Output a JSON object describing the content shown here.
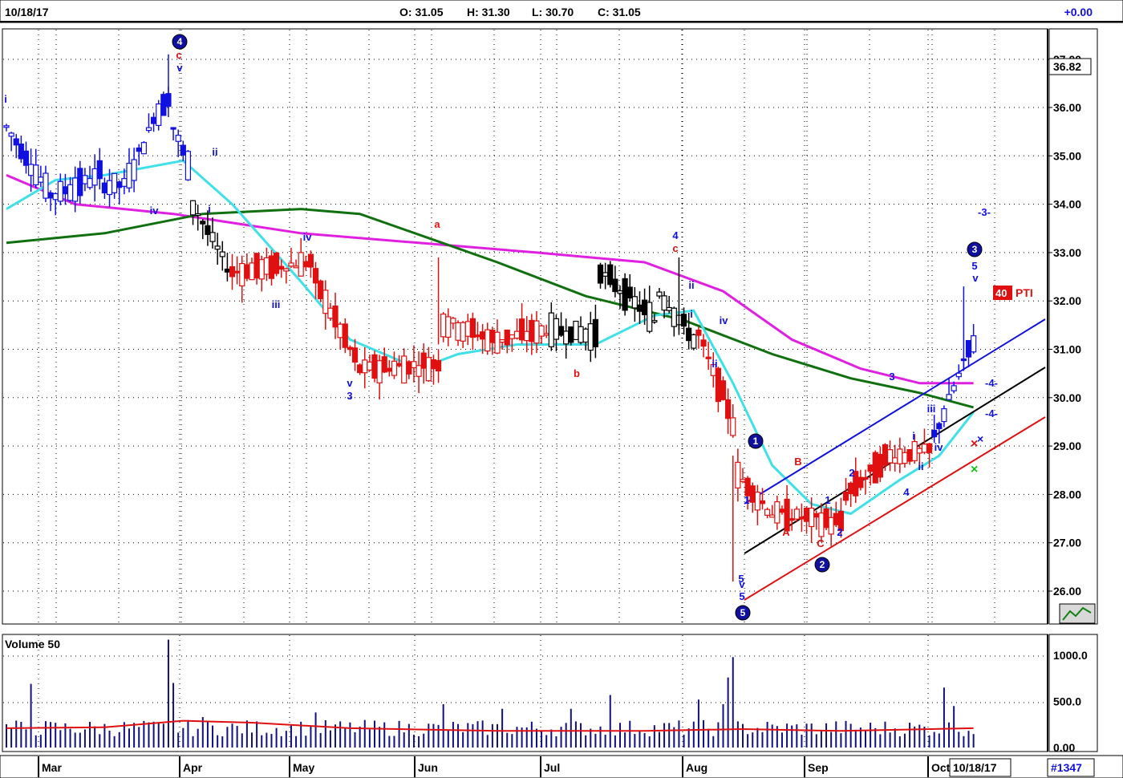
{
  "header": {
    "date": "10/18/17",
    "open": "O: 31.05",
    "high": "H: 31.30",
    "low": "L: 30.70",
    "close": "C: 31.05",
    "change": "+0.00"
  },
  "price_axis": {
    "last_price": "36.82",
    "ticks": [
      "27.00",
      "36.00",
      "35.00",
      "34.00",
      "33.00",
      "32.00",
      "31.00",
      "30.00",
      "29.00",
      "28.00",
      "27.00",
      "26.00"
    ]
  },
  "volume_panel": {
    "title": "Volume 50",
    "ticks": [
      "1000.0",
      "500.0",
      "0.00"
    ]
  },
  "bottom_bar": {
    "current_date": "10/18/17",
    "symbol_count": "#1347"
  },
  "indicator": {
    "badge_value": "40",
    "badge_label": "PTI"
  },
  "colors": {
    "up": "#1010e0",
    "down": "#e01010",
    "neutral": "#000000",
    "ma_fast": "#40e0e8",
    "ma_mid": "#107010",
    "ma_slow": "#e020e0",
    "vol_bar": "#101080",
    "vol_avg": "#e01010",
    "grid": "#000000"
  },
  "chart_data": {
    "type": "candlestick",
    "y_range": [
      25.8,
      27.35
    ],
    "x_months": [
      "Mar",
      "Apr",
      "May",
      "Jun",
      "Jul",
      "Aug",
      "Sep",
      "Oct"
    ],
    "segments": [
      {
        "start_day": 0,
        "end_day": 9,
        "from": 35.6,
        "to": 34.2,
        "color": "up"
      },
      {
        "start_day": 10,
        "end_day": 19,
        "from": 34.2,
        "to": 34.6,
        "color": "up"
      },
      {
        "start_day": 20,
        "end_day": 24,
        "from": 34.4,
        "to": 34.4,
        "color": "up"
      },
      {
        "start_day": 25,
        "end_day": 29,
        "from": 34.6,
        "to": 35.5,
        "color": "up"
      },
      {
        "start_day": 30,
        "end_day": 33,
        "from": 35.8,
        "to": 36.2,
        "color": "up"
      },
      {
        "start_day": 34,
        "end_day": 37,
        "from": 35.6,
        "to": 34.8,
        "color": "up"
      },
      {
        "start_day": 38,
        "end_day": 45,
        "from": 34.0,
        "to": 32.7,
        "color": "neutral"
      },
      {
        "start_day": 46,
        "end_day": 62,
        "from": 32.6,
        "to": 32.8,
        "color": "down"
      },
      {
        "start_day": 63,
        "end_day": 72,
        "from": 32.4,
        "to": 30.6,
        "color": "down"
      },
      {
        "start_day": 73,
        "end_day": 88,
        "from": 30.6,
        "to": 30.7,
        "color": "down"
      },
      {
        "start_day": 89,
        "end_day": 99,
        "from": 31.6,
        "to": 31.2,
        "color": "down"
      },
      {
        "start_day": 100,
        "end_day": 110,
        "from": 31.2,
        "to": 31.4,
        "color": "down"
      },
      {
        "start_day": 111,
        "end_day": 120,
        "from": 31.4,
        "to": 31.3,
        "color": "neutral"
      },
      {
        "start_day": 121,
        "end_day": 132,
        "from": 32.6,
        "to": 31.6,
        "color": "neutral"
      },
      {
        "start_day": 133,
        "end_day": 140,
        "from": 32.2,
        "to": 31.2,
        "color": "neutral"
      },
      {
        "start_day": 141,
        "end_day": 148,
        "from": 31.3,
        "to": 29.5,
        "color": "down"
      },
      {
        "start_day": 149,
        "end_day": 156,
        "from": 28.4,
        "to": 27.6,
        "color": "down"
      },
      {
        "start_day": 157,
        "end_day": 170,
        "from": 27.6,
        "to": 27.4,
        "color": "down"
      },
      {
        "start_day": 171,
        "end_day": 180,
        "from": 28.0,
        "to": 28.8,
        "color": "down"
      },
      {
        "start_day": 181,
        "end_day": 188,
        "from": 28.8,
        "to": 28.9,
        "color": "down"
      },
      {
        "start_day": 189,
        "end_day": 197,
        "from": 29.2,
        "to": 31.2,
        "color": "up"
      }
    ],
    "ma_fast": [
      [
        0,
        33.9
      ],
      [
        10,
        34.5
      ],
      [
        20,
        34.6
      ],
      [
        36,
        34.9
      ],
      [
        46,
        34.0
      ],
      [
        60,
        32.4
      ],
      [
        70,
        31.2
      ],
      [
        84,
        30.6
      ],
      [
        92,
        30.9
      ],
      [
        104,
        31.1
      ],
      [
        120,
        31.1
      ],
      [
        132,
        31.7
      ],
      [
        140,
        31.8
      ],
      [
        148,
        30.3
      ],
      [
        156,
        28.6
      ],
      [
        164,
        27.8
      ],
      [
        172,
        27.6
      ],
      [
        182,
        28.3
      ],
      [
        190,
        28.8
      ],
      [
        197,
        29.7
      ]
    ],
    "ma_mid": [
      [
        0,
        33.2
      ],
      [
        20,
        33.4
      ],
      [
        40,
        33.8
      ],
      [
        60,
        33.9
      ],
      [
        72,
        33.8
      ],
      [
        86,
        33.3
      ],
      [
        100,
        32.8
      ],
      [
        118,
        32.1
      ],
      [
        138,
        31.6
      ],
      [
        156,
        30.9
      ],
      [
        172,
        30.4
      ],
      [
        186,
        30.1
      ],
      [
        197,
        29.8
      ]
    ],
    "ma_slow": [
      [
        0,
        34.6
      ],
      [
        14,
        34.0
      ],
      [
        34,
        33.8
      ],
      [
        60,
        33.4
      ],
      [
        84,
        33.2
      ],
      [
        108,
        33.0
      ],
      [
        130,
        32.8
      ],
      [
        146,
        32.2
      ],
      [
        160,
        31.2
      ],
      [
        174,
        30.6
      ],
      [
        186,
        30.3
      ],
      [
        197,
        30.3
      ]
    ],
    "volume_avg": [
      [
        0,
        210
      ],
      [
        20,
        220
      ],
      [
        36,
        290
      ],
      [
        50,
        270
      ],
      [
        70,
        210
      ],
      [
        100,
        180
      ],
      [
        130,
        180
      ],
      [
        150,
        200
      ],
      [
        170,
        180
      ],
      [
        197,
        210
      ]
    ],
    "volume_spikes": [
      [
        5,
        690
      ],
      [
        33,
        1170
      ],
      [
        34,
        700
      ],
      [
        40,
        330
      ],
      [
        63,
        380
      ],
      [
        89,
        470
      ],
      [
        101,
        420
      ],
      [
        115,
        420
      ],
      [
        123,
        570
      ],
      [
        141,
        520
      ],
      [
        146,
        470
      ],
      [
        147,
        760
      ],
      [
        148,
        980
      ],
      [
        191,
        650
      ],
      [
        193,
        450
      ]
    ]
  },
  "annotations": [
    {
      "t": "i",
      "c": "#1010e0"
    },
    {
      "t": "4",
      "c": "#1010e0"
    },
    {
      "t": "c",
      "c": "#e01010"
    },
    {
      "t": "v",
      "c": "#1010e0"
    },
    {
      "t": "ii",
      "c": "#1010e0"
    },
    {
      "t": "iv",
      "c": "#1010e0"
    },
    {
      "t": "i",
      "c": "#1010e0"
    },
    {
      "t": "iv",
      "c": "#1010e0"
    },
    {
      "t": "iii",
      "c": "#1010e0"
    },
    {
      "t": "a",
      "c": "#e01010"
    },
    {
      "t": "v",
      "c": "#1010e0"
    },
    {
      "t": "3",
      "c": "#1010e0"
    },
    {
      "t": "b",
      "c": "#e01010"
    },
    {
      "t": "4",
      "c": "#1010e0"
    },
    {
      "t": "c",
      "c": "#e01010"
    },
    {
      "t": "ii",
      "c": "#1010e0"
    },
    {
      "t": "i",
      "c": "#1010e0"
    },
    {
      "t": "iv",
      "c": "#1010e0"
    },
    {
      "t": "ii",
      "c": "#1010e0"
    },
    {
      "t": "1",
      "c": "#1010e0"
    },
    {
      "t": "B",
      "c": "#e01010"
    },
    {
      "t": "A",
      "c": "#e01010"
    },
    {
      "t": "1",
      "c": "#1010e0"
    },
    {
      "t": "2",
      "c": "#1010e0"
    },
    {
      "t": "C",
      "c": "#e01010"
    },
    {
      "t": "2",
      "c": "#1010e0"
    },
    {
      "t": "3",
      "c": "#1010e0"
    },
    {
      "t": "i",
      "c": "#1010e0"
    },
    {
      "t": "ii",
      "c": "#1010e0"
    },
    {
      "t": "iii",
      "c": "#1010e0"
    },
    {
      "t": "iv",
      "c": "#1010e0"
    },
    {
      "t": "4",
      "c": "#1010e0"
    },
    {
      "t": "3",
      "c": "#1010e0"
    },
    {
      "t": "5",
      "c": "#1010e0"
    },
    {
      "t": "v",
      "c": "#1010e0"
    },
    {
      "t": "-3-",
      "c": "#1010e0"
    },
    {
      "t": "-4-",
      "c": "#1010e0"
    },
    {
      "t": "-4-",
      "c": "#1010e0"
    },
    {
      "t": "v",
      "c": "#1010e0"
    },
    {
      "t": "5",
      "c": "#1010e0"
    },
    {
      "t": "5",
      "c": "#1010e0"
    }
  ]
}
